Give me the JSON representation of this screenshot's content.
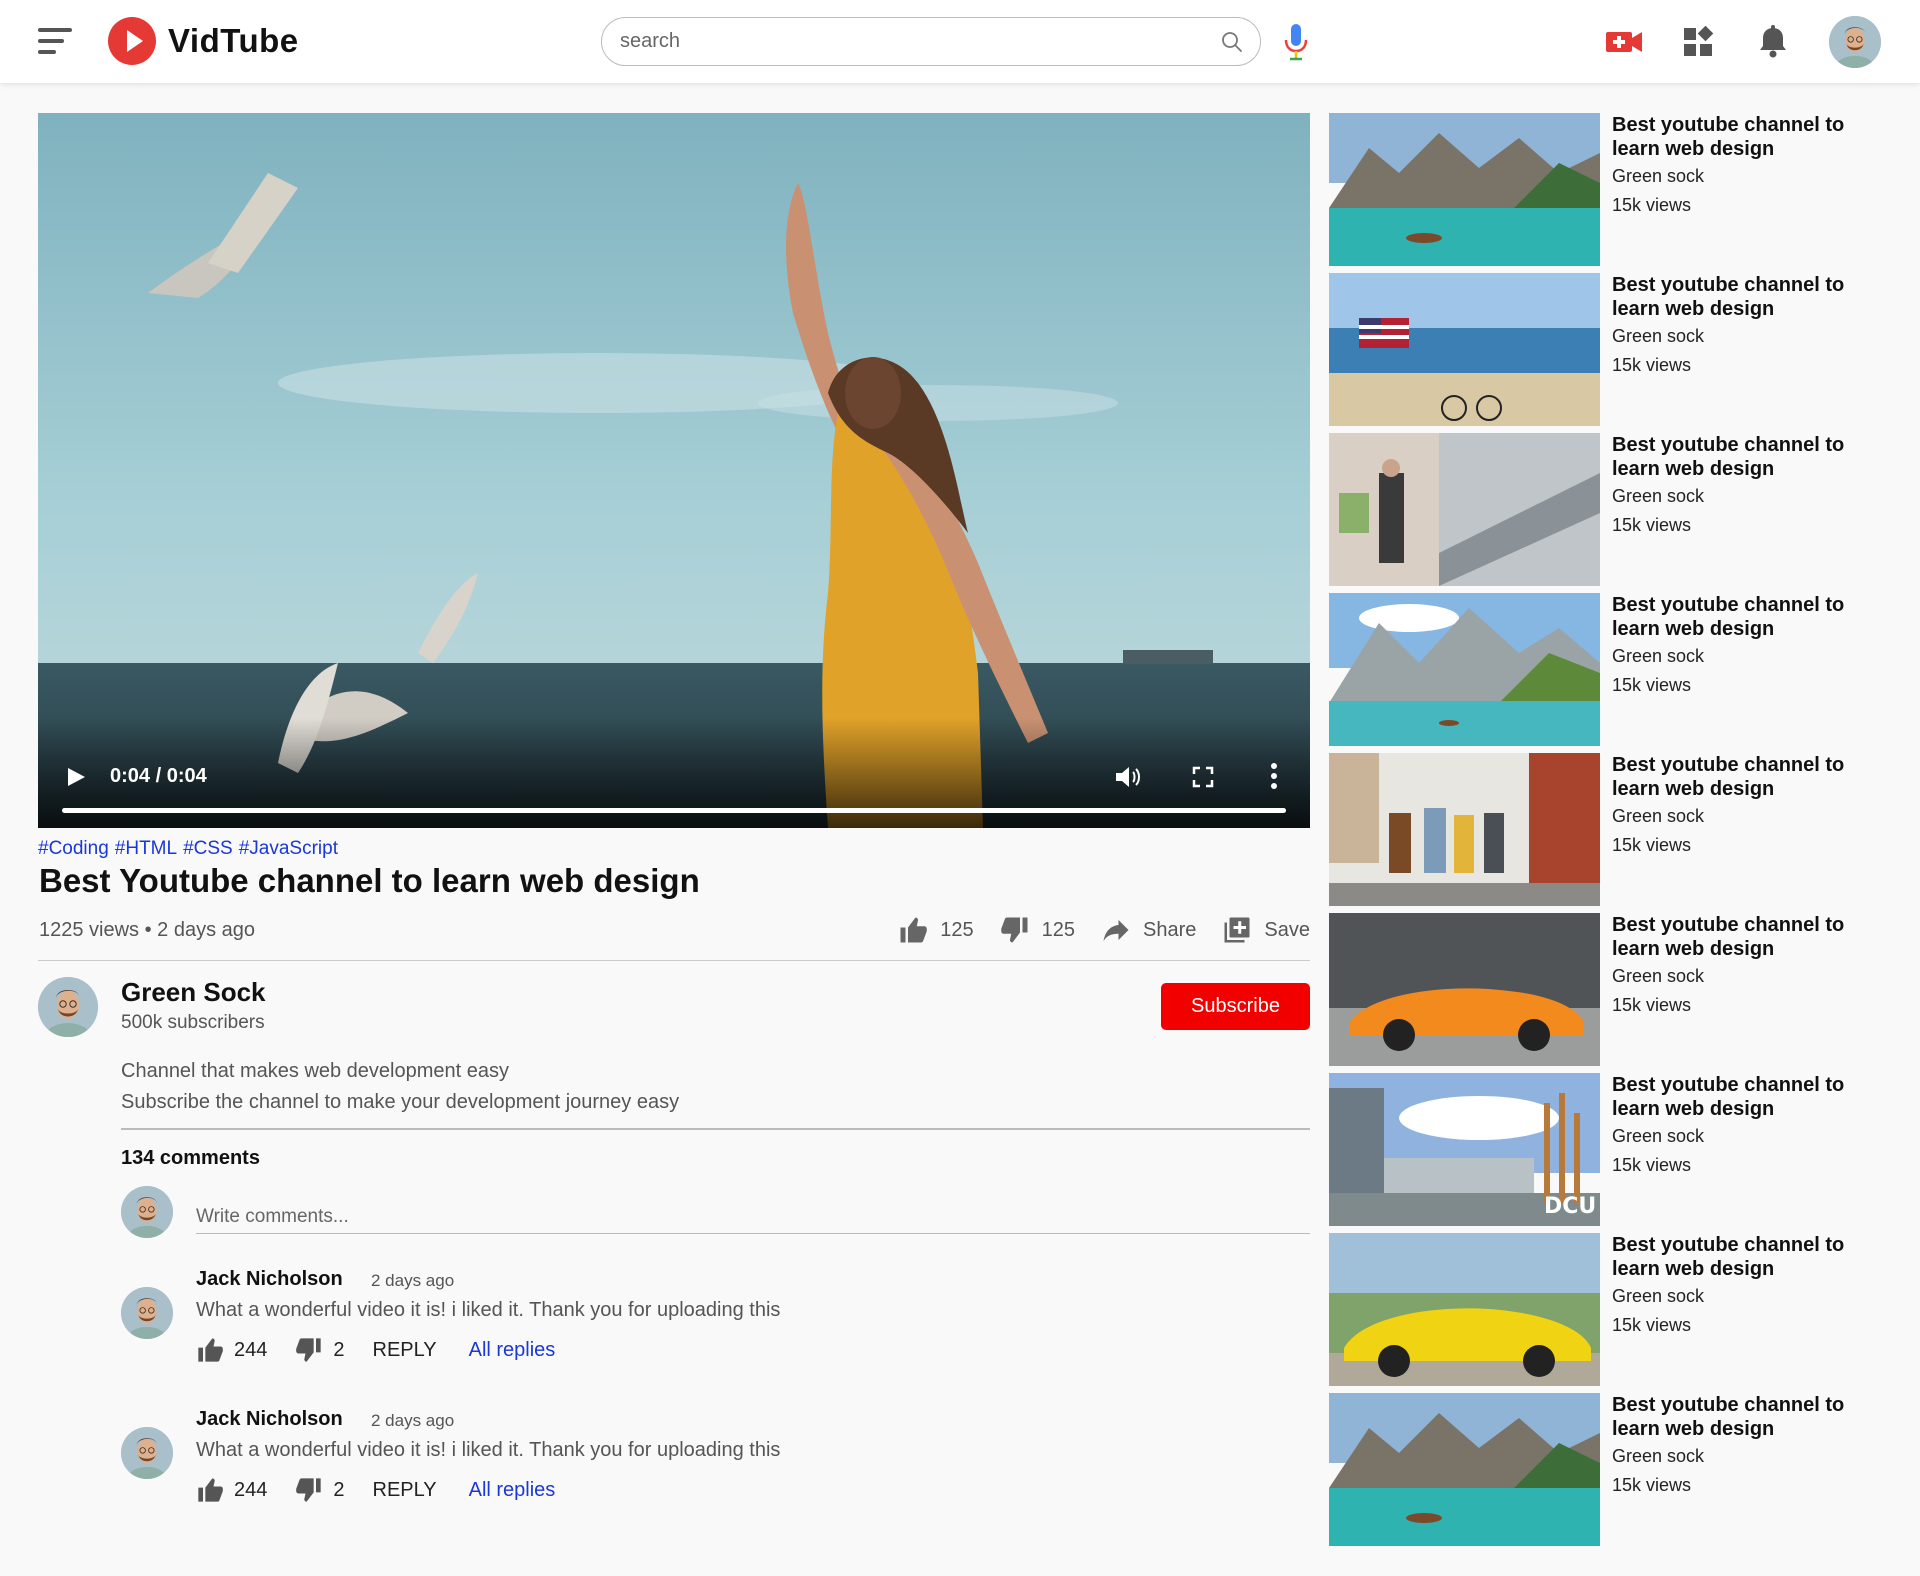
{
  "app": {
    "name": "VidTube"
  },
  "search": {
    "placeholder": "search"
  },
  "video": {
    "time": "0:04 / 0:04",
    "progress": 1.0,
    "tags": [
      "#Coding",
      "#HTML",
      "#CSS",
      "#JavaScript"
    ],
    "title": "Best Youtube channel to learn web design",
    "meta": "1225 views • 2 days ago",
    "likes": "125",
    "dislikes": "125",
    "share_label": "Share",
    "save_label": "Save"
  },
  "channel": {
    "name": "Green Sock",
    "subscribers": "500k subscribers",
    "subscribe_label": "Subscribe",
    "description_line1": "Channel that makes web development easy",
    "description_line2": "Subscribe the channel to make your development journey easy"
  },
  "comments": {
    "count_label": "134 comments",
    "input_placeholder": "Write comments...",
    "items": [
      {
        "author": "Jack Nicholson",
        "time": "2 days ago",
        "text": "What a wonderful video it is! i liked it. Thank you for uploading this",
        "likes": "244",
        "dislikes": "2",
        "reply_label": "REPLY",
        "replies_label": "All replies"
      },
      {
        "author": "Jack Nicholson",
        "time": "2 days ago",
        "text": "What a wonderful video it is! i liked it. Thank you for uploading this",
        "likes": "244",
        "dislikes": "2",
        "reply_label": "REPLY",
        "replies_label": "All replies"
      }
    ]
  },
  "sidebar": {
    "items": [
      {
        "title": "Best youtube channel to learn web design",
        "channel": "Green sock",
        "views": "15k views",
        "thumb": "lake"
      },
      {
        "title": "Best youtube channel to learn web design",
        "channel": "Green sock",
        "views": "15k views",
        "thumb": "beach"
      },
      {
        "title": "Best youtube channel to learn web design",
        "channel": "Green sock",
        "views": "15k views",
        "thumb": "mall"
      },
      {
        "title": "Best youtube channel to learn web design",
        "channel": "Green sock",
        "views": "15k views",
        "thumb": "mountains"
      },
      {
        "title": "Best youtube channel to learn web design",
        "channel": "Green sock",
        "views": "15k views",
        "thumb": "street"
      },
      {
        "title": "Best youtube channel to learn web design",
        "channel": "Green sock",
        "views": "15k views",
        "thumb": "orange-car"
      },
      {
        "title": "Best youtube channel to learn web design",
        "channel": "Green sock",
        "views": "15k views",
        "thumb": "building",
        "thumb_text": "DCU"
      },
      {
        "title": "Best youtube channel to learn web design",
        "channel": "Green sock",
        "views": "15k views",
        "thumb": "yellow-car"
      },
      {
        "title": "Best youtube channel to learn web design",
        "channel": "Green sock",
        "views": "15k views",
        "thumb": "lake"
      }
    ]
  },
  "colors": {
    "brand": "#e53935",
    "subscribe": "#f20000",
    "link": "#1a37d8"
  }
}
